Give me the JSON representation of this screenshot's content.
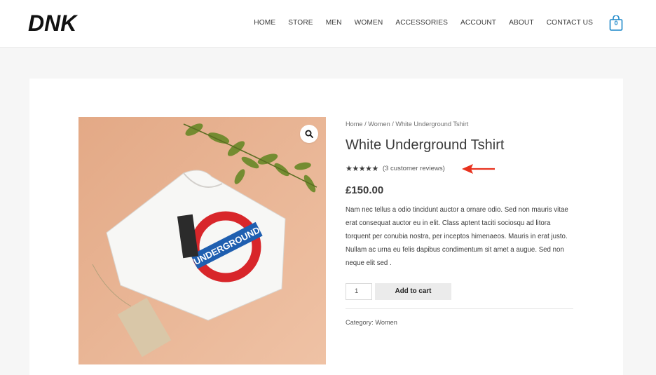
{
  "header": {
    "logo_text": "DNK",
    "nav": [
      "HOME",
      "STORE",
      "MEN",
      "WOMEN",
      "ACCESSORIES",
      "ACCOUNT",
      "ABOUT",
      "CONTACT US"
    ],
    "cart_count": "0"
  },
  "product": {
    "breadcrumb": [
      "Home",
      "Women",
      "White Underground Tshirt"
    ],
    "breadcrumb_sep": " / ",
    "title": "White Underground Tshirt",
    "stars": "★★★★★",
    "rating": 5,
    "reviews_text": "(3 customer reviews)",
    "price": "£150.00",
    "description": "Nam nec tellus a odio tincidunt auctor a ornare odio. Sed non mauris vitae erat consequat auctor eu in elit. Class aptent taciti sociosqu ad litora torquent per conubia nostra, per inceptos himenaeos. Mauris in erat justo. Nullam ac urna eu felis dapibus condimentum sit amet a augue. Sed non neque elit sed .",
    "quantity": "1",
    "add_to_cart": "Add to cart",
    "category_label": "Category:",
    "category": "Women",
    "image_text": "UNDERGROUND"
  },
  "colors": {
    "accent": "#1b87c9",
    "arrow": "#e8321e",
    "background": "#f6f6f6"
  },
  "icons": {
    "zoom": "search-icon",
    "cart": "shopping-bag-icon",
    "arrow": "arrow-left-icon"
  }
}
